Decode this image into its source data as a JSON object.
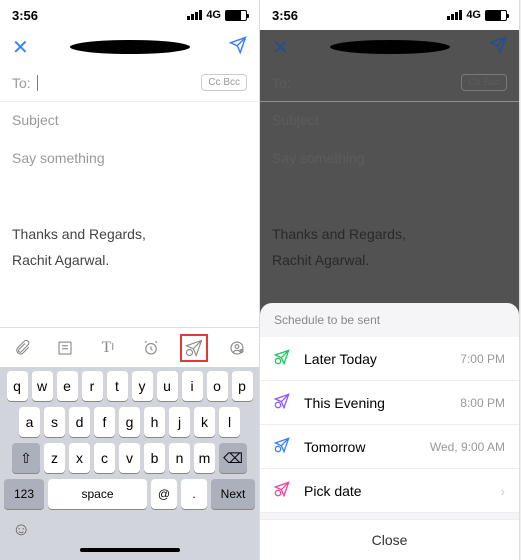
{
  "status": {
    "time": "3:56",
    "network": "4G"
  },
  "compose": {
    "to_label": "To:",
    "cc_label": "Cc Bcc",
    "subject_placeholder": "Subject",
    "body_placeholder": "Say something",
    "signature_line1": "Thanks and Regards,",
    "signature_line2": "Rachit Agarwal."
  },
  "keyboard": {
    "row1": [
      "q",
      "w",
      "e",
      "r",
      "t",
      "y",
      "u",
      "i",
      "o",
      "p"
    ],
    "row2": [
      "a",
      "s",
      "d",
      "f",
      "g",
      "h",
      "j",
      "k",
      "l"
    ],
    "row3": [
      "z",
      "x",
      "c",
      "v",
      "b",
      "n",
      "m"
    ],
    "num_key": "123",
    "space_key": "space",
    "at_key": "@",
    "dot_key": ".",
    "next_key": "Next"
  },
  "schedule": {
    "header": "Schedule to be sent",
    "items": [
      {
        "label": "Later Today",
        "time": "7:00 PM",
        "color": "#22c55e"
      },
      {
        "label": "This Evening",
        "time": "8:00 PM",
        "color": "#8b5cf6"
      },
      {
        "label": "Tomorrow",
        "time": "Wed, 9:00 AM",
        "color": "#3b82f6"
      },
      {
        "label": "Pick date",
        "time": "",
        "color": "#ec4899"
      }
    ],
    "close": "Close"
  }
}
